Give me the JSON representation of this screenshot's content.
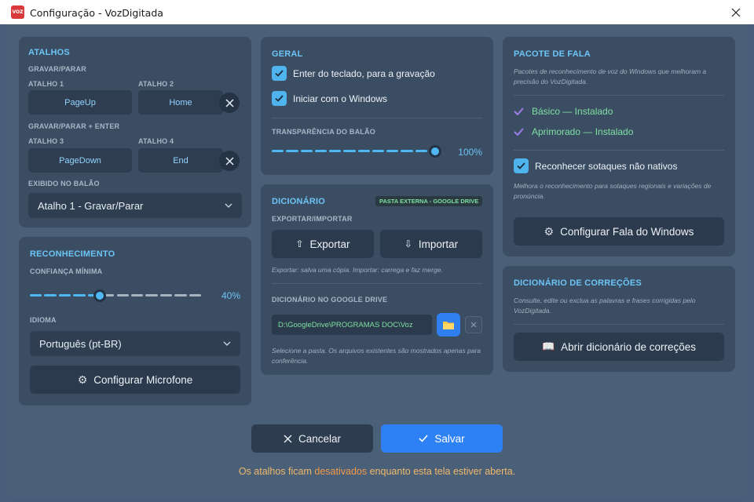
{
  "window": {
    "title": "Configuração - VozDigitada",
    "icon_text": "VOZ",
    "colors": {
      "accent": "#6cc4f5",
      "success": "#7fe0a2",
      "primary": "#2e80f5",
      "warning": "#f0b86a"
    }
  },
  "atalhos": {
    "title": "ATALHOS",
    "group1": "GRAVAR/PARAR",
    "a1_label": "ATALHO 1",
    "a1_value": "PageUp",
    "a2_label": "ATALHO 2",
    "a2_value": "Home",
    "group2": "GRAVAR/PARAR + ENTER",
    "a3_label": "ATALHO 3",
    "a3_value": "PageDown",
    "a4_label": "ATALHO 4",
    "a4_value": "End",
    "balao_label": "EXIBIDO NO BALÃO",
    "balao_value": "Atalho 1 - Gravar/Parar"
  },
  "reconhecimento": {
    "title": "RECONHECIMENTO",
    "conf_label": "CONFIANÇA MÍNIMA",
    "conf_value": 40,
    "conf_text": "40%",
    "idioma_label": "IDIOMA",
    "idioma_value": "Português (pt-BR)",
    "mic_button": "Configurar Microfone"
  },
  "geral": {
    "title": "GERAL",
    "opt1": "Enter do teclado, para a gravação",
    "opt2": "Iniciar com o Windows",
    "transp_label": "TRANSPARÊNCIA DO BALÃO",
    "transp_value": 100,
    "transp_text": "100%"
  },
  "dicionario": {
    "title": "DICIONÁRIO",
    "badge": "PASTA EXTERNA - GOOGLE DRIVE",
    "exp_label": "EXPORTAR/IMPORTAR",
    "export_btn": "Exportar",
    "import_btn": "Importar",
    "exp_note": "Exportar: salva uma cópia. Importar: carrega e faz merge.",
    "drive_label": "DICIONÁRIO NO GOOGLE DRIVE",
    "drive_path": "D:\\GoogleDrive\\PROGRAMAS DOC\\Voz",
    "drive_note": "Selecione a pasta. Os arquivos existentes são mostrados apenas para conferência."
  },
  "pacote": {
    "title": "PACOTE DE FALA",
    "desc": "Pacotes de reconhecimento de voz do Windows que melhoram a precisão do VozDigitada.",
    "status1": "Básico — Instalado",
    "status2": "Aprimorado — Instalado",
    "sotaque": "Reconhecer sotaques não nativos",
    "sotaque_note": "Melhora o reconhecimento para sotaques regionais e variações de pronúncia.",
    "config_btn": "Configurar Fala do Windows"
  },
  "correcoes": {
    "title": "DICIONÁRIO DE CORREÇÕES",
    "desc": "Consulte, edite ou exclua as palavras e frases corrigidas pelo VozDigitada.",
    "open_btn": "Abrir dicionário de correções"
  },
  "actions": {
    "cancel": "Cancelar",
    "save": "Salvar"
  },
  "footer": {
    "pre": "Os atalhos ficam",
    "hl": "desativados",
    "post": "enquanto esta tela estiver aberta."
  }
}
